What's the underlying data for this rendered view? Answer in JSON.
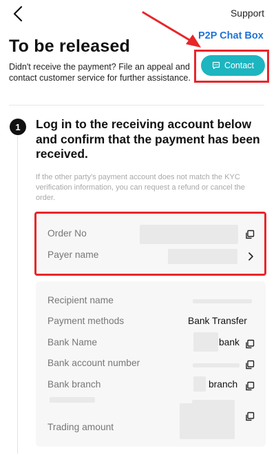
{
  "header": {
    "back_icon": "chevron-left-icon",
    "support_label": "Support"
  },
  "annotation": {
    "label": "P2P Chat Box",
    "color": "#1e73d6",
    "frame_color": "#e8262a"
  },
  "status": {
    "title": "To be released",
    "subtitle": "Didn't receive the payment? File an appeal and contact customer service for further assistance."
  },
  "contact": {
    "label": "Contact",
    "icon": "chat-icon",
    "color": "#1db5c0"
  },
  "step": {
    "number": "1",
    "title": "Log in to the receiving account below and confirm that the payment has been received.",
    "note": "If the other party's payment account does not match the KYC verification information, you can request a refund or cancel the order."
  },
  "order_info": {
    "order_no_label": "Order No",
    "payer_name_label": "Payer name"
  },
  "payment_info": {
    "recipient_name_label": "Recipient name",
    "payment_methods_label": "Payment methods",
    "payment_methods_value": "Bank Transfer",
    "bank_name_label": "Bank Name",
    "bank_name_value": "bank",
    "bank_account_label": "Bank account number",
    "bank_branch_label": "Bank branch",
    "bank_branch_value": "branch",
    "trading_amount_label": "Trading amount"
  }
}
